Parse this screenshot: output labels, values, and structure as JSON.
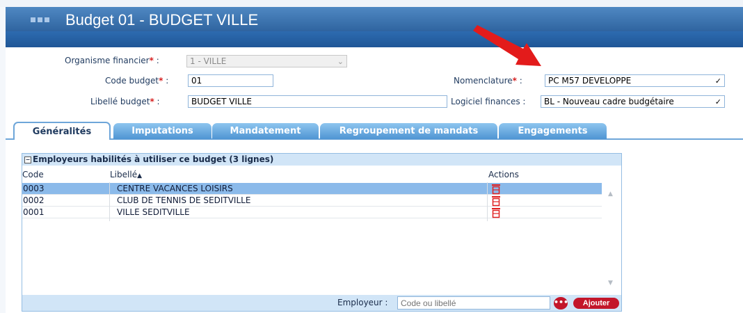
{
  "window": {
    "title": "Budget 01 - BUDGET VILLE"
  },
  "form": {
    "organisme": {
      "label": "Organisme financier",
      "value": "1 - VILLE"
    },
    "code_budget": {
      "label": "Code budget",
      "value": "01"
    },
    "libelle_budget": {
      "label": "Libellé budget",
      "value": "BUDGET VILLE"
    },
    "nomenclature": {
      "label": "Nomenclature",
      "value": "PC M57 DEVELOPPE"
    },
    "logiciel": {
      "label": "Logiciel finances :",
      "value": "BL - Nouveau cadre budgétaire"
    },
    "required_mark": "*",
    "colon": ":"
  },
  "tabs": [
    {
      "label": "Généralités",
      "active": true
    },
    {
      "label": "Imputations",
      "active": false
    },
    {
      "label": "Mandatement",
      "active": false
    },
    {
      "label": "Regroupement de mandats",
      "active": false
    },
    {
      "label": "Engagements",
      "active": false
    }
  ],
  "employeurs": {
    "title": "Employeurs habilités à utiliser ce budget (3 lignes)",
    "columns": {
      "code": "Code",
      "libelle": "Libellé",
      "actions": "Actions"
    },
    "rows": [
      {
        "code": "0003",
        "libelle": "CENTRE VACANCES LOISIRS",
        "selected": true
      },
      {
        "code": "0002",
        "libelle": "CLUB DE TENNIS DE SEDITVILLE",
        "selected": false
      },
      {
        "code": "0001",
        "libelle": "VILLE SEDITVILLE",
        "selected": false
      }
    ],
    "footer": {
      "label": "Employeur :",
      "placeholder": "Code ou libellé",
      "add_button": "Ajouter"
    }
  },
  "icons": {
    "delete": "trash-icon",
    "more": "more-options-icon",
    "sort": "sort-ascending-icon",
    "collapse": "collapse-icon",
    "select": "chevron-down-icon",
    "annotation": "red-arrow-annotation"
  },
  "colors": {
    "title_bar": "#2f64a0",
    "tab_blue": "#4f95d3",
    "selected_row": "#8bbaea",
    "required": "#d61f1f",
    "action_red": "#c3162a",
    "annotation_arrow": "#e31b1b"
  }
}
